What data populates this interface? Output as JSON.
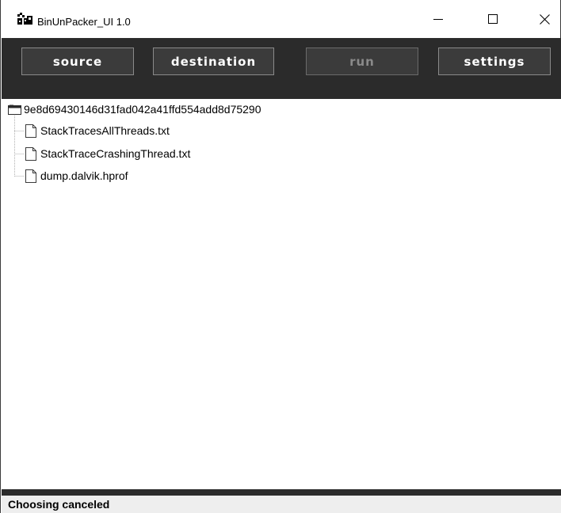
{
  "window": {
    "title": "BinUnPacker_UI 1.0",
    "icon": "app-icon",
    "controls": [
      "minimize-icon",
      "maximize-icon",
      "close-icon"
    ]
  },
  "toolbar": {
    "source_label": "source",
    "destination_label": "destination",
    "run_label": "run",
    "run_enabled": false,
    "settings_label": "settings"
  },
  "tree": {
    "root": {
      "label": "9e8d69430146d31fad042a41ffd554add8d75290",
      "icon": "folder-icon",
      "children": [
        {
          "label": "StackTracesAllThreads.txt",
          "icon": "file-icon"
        },
        {
          "label": "StackTraceCrashingThread.txt",
          "icon": "file-icon"
        },
        {
          "label": "dump.dalvik.hprof",
          "icon": "file-icon"
        }
      ]
    }
  },
  "status": {
    "text": "Choosing canceled"
  },
  "colors": {
    "toolbar_bg": "#2b2b2b",
    "button_bg": "#3b3b3b",
    "button_border": "#8a8a8a",
    "disabled_text": "#8a8a8a",
    "status_bg": "#eeeeee"
  }
}
